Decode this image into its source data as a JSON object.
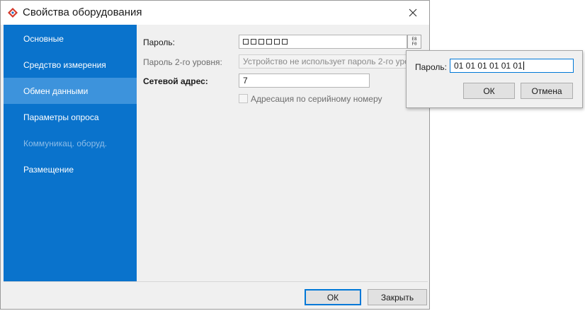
{
  "window": {
    "title": "Свойства оборудования",
    "icon": "app-diamond-icon"
  },
  "sidebar": {
    "items": [
      {
        "label": "Основные",
        "state": "normal"
      },
      {
        "label": "Средство измерения",
        "state": "normal"
      },
      {
        "label": "Обмен данными",
        "state": "selected"
      },
      {
        "label": "Параметры опроса",
        "state": "normal"
      },
      {
        "label": "Коммуникац. оборуд.",
        "state": "disabled"
      },
      {
        "label": "Размещение",
        "state": "normal"
      }
    ]
  },
  "form": {
    "password_label": "Пароль:",
    "password_mask_count": 6,
    "keyboard_icon_text": "E8 F0",
    "password2_label": "Пароль 2-го уровня:",
    "password2_value": "Устройство не использует пароль 2-го уровня",
    "network_label": "Сетевой адрес:",
    "network_value": "7",
    "serial_checkbox_label": "Адресация по серийному номеру",
    "serial_checkbox_checked": false
  },
  "footer": {
    "ok_label": "ОК",
    "close_label": "Закрыть"
  },
  "popup": {
    "password_label": "Пароль:",
    "password_value": "01 01 01 01 01 01",
    "ok_label": "ОК",
    "cancel_label": "Отмена"
  },
  "colors": {
    "sidebar": "#0a73cc",
    "sidebar_selected": "#3d93dc",
    "accent": "#0078d7"
  }
}
